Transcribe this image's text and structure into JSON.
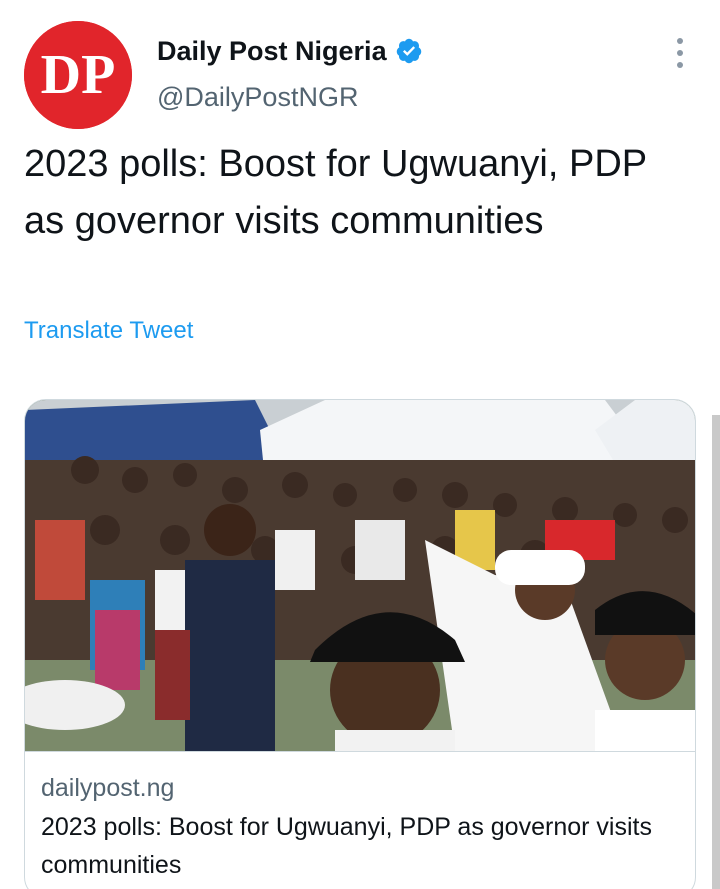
{
  "account": {
    "display_name": "Daily Post Nigeria",
    "handle": "@DailyPostNGR",
    "avatar_logo": "DP",
    "verified": true,
    "avatar_color": "#e1252b"
  },
  "tweet": {
    "text": "2023 polls: Boost for Ugwuanyi, PDP as governor visits communities",
    "translate_label": "Translate Tweet"
  },
  "card": {
    "domain": "dailypost.ng",
    "title": "2023 polls: Boost for Ugwuanyi, PDP as governor visits communities"
  },
  "colors": {
    "link": "#1d9bf0",
    "verified": "#1d9bf0",
    "secondary_text": "#536471"
  },
  "icons": {
    "verified": "verified-badge-icon",
    "more": "more-vertical-icon"
  }
}
